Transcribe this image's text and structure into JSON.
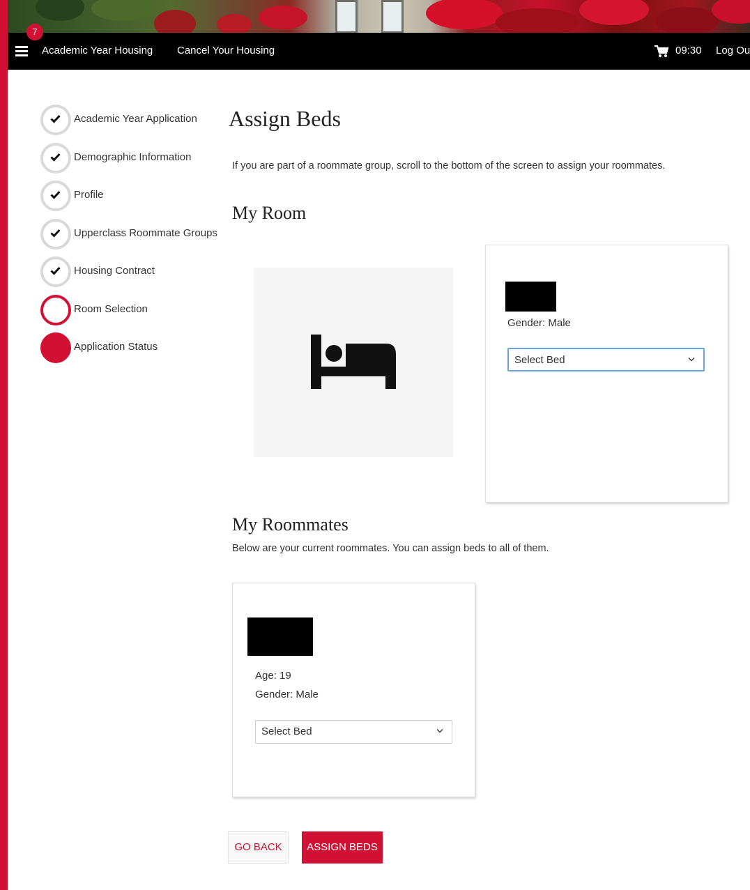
{
  "colors": {
    "accent": "#d21034",
    "navbar": "#000000",
    "step_done_ring": "#d9d9d9",
    "room_image_bg": "#f6f5f5",
    "select_focus": "#6fa3dd"
  },
  "nav": {
    "notification_count": "7",
    "links": [
      "Academic Year Housing",
      "Cancel Your Housing"
    ],
    "time": "09:30",
    "logout": "Log Ou",
    "icons": [
      "hamburger-menu-icon",
      "shopping-cart-icon"
    ]
  },
  "steps": [
    {
      "label": "Academic Year Application",
      "state": "complete"
    },
    {
      "label": "Demographic Information",
      "state": "complete"
    },
    {
      "label": "Profile",
      "state": "complete"
    },
    {
      "label": "Upperclass Roommate Groups",
      "state": "complete"
    },
    {
      "label": "Housing Contract",
      "state": "complete"
    },
    {
      "label": "Room Selection",
      "state": "current"
    },
    {
      "label": "Application Status",
      "state": "upcoming"
    }
  ],
  "page": {
    "title": "Assign Beds",
    "intro": "If you are part of a roommate group, scroll to the bottom of the screen to assign your roommates."
  },
  "my_room": {
    "title": "My Room",
    "image_icon": "bed-icon",
    "card": {
      "gender": "Gender: Male",
      "select_value": "Select Bed"
    }
  },
  "roommates": {
    "title": "My Roommates",
    "description": "Below are your current roommates. You can assign beds to all of them.",
    "cards": [
      {
        "age": "Age: 19",
        "gender": "Gender: Male",
        "select_value": "Select Bed"
      }
    ]
  },
  "buttons": {
    "back": "GO BACK",
    "assign": "ASSIGN BEDS"
  }
}
